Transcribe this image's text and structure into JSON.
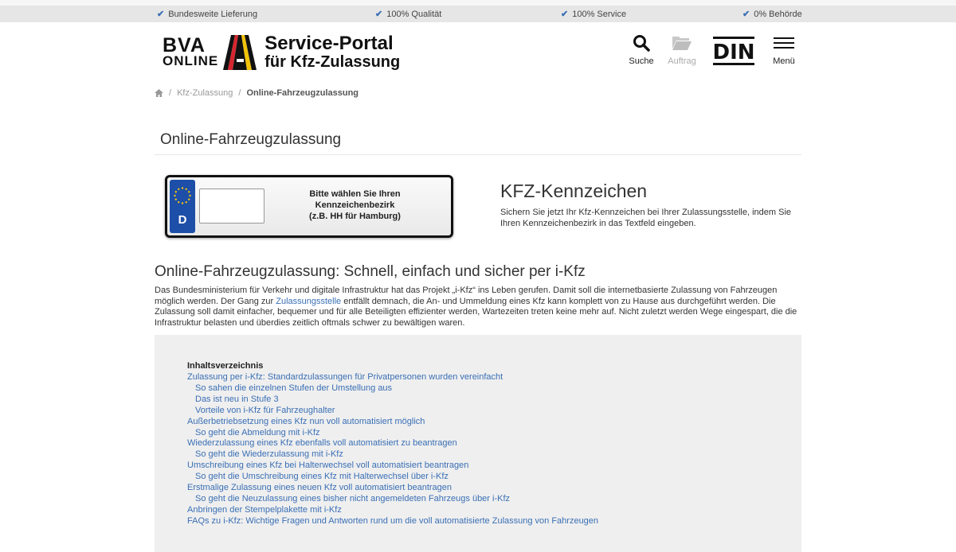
{
  "topbar": {
    "usps": [
      "Bundesweite Lieferung",
      "100% Qualität",
      "100% Service",
      "0% Behörde"
    ]
  },
  "header": {
    "logo_bva": "BVA",
    "logo_online": "ONLINE",
    "logo_portal_line1": "Service-Portal",
    "logo_portal_line2": "für Kfz-Zulassung",
    "search_label": "Suche",
    "order_label": "Auftrag",
    "din_label": "DIN",
    "menu_label": "Menü"
  },
  "breadcrumb": {
    "separator": "/",
    "item1": "Kfz-Zulassung",
    "current": "Online-Fahrzeugzulassung"
  },
  "page_title": "Online-Fahrzeugzulassung",
  "plate": {
    "country": "D",
    "input_value": "",
    "hint_line1": "Bitte wählen Sie Ihren Kennzeichenbezirk",
    "hint_line2": "(z.B. HH für Hamburg)"
  },
  "kfz": {
    "title": "KFZ-Kennzeichen",
    "text": "Sichern Sie jetzt Ihr Kfz-Kennzeichen bei Ihrer Zulassungsstelle, indem Sie Ihren Kennzeichenbezirk in das Textfeld eingeben."
  },
  "main": {
    "heading": "Online-Fahrzeugzulassung: Schnell, einfach und sicher per i-Kfz",
    "intro_part1": "Das Bundesministerium für Verkehr und digitale Infrastruktur hat das Projekt „i-Kfz“ ins Leben gerufen. Damit soll die internetbasierte Zulassung von Fahrzeugen möglich werden. Der Gang zur ",
    "intro_link": "Zulassungsstelle",
    "intro_part2": " entfällt demnach, die An- und Ummeldung eines Kfz kann komplett von zu Hause aus durchgeführt werden. Die Zulassung soll damit einfacher, bequemer und für alle Beteiligten effizienter werden, Wartezeiten treten keine mehr auf. Nicht zuletzt werden Wege eingespart, die die Infrastruktur belasten und überdies zeitlich oftmals schwer zu bewältigen waren."
  },
  "toc": {
    "title": "Inhaltsverzeichnis",
    "items": [
      {
        "label": "Zulassung per i-Kfz: Standardzulassungen für Privatpersonen wurden vereinfacht",
        "sub": false
      },
      {
        "label": "So sahen die einzelnen Stufen der Umstellung aus",
        "sub": true
      },
      {
        "label": "Das ist neu in Stufe 3",
        "sub": true
      },
      {
        "label": "Vorteile von i-Kfz für Fahrzeughalter",
        "sub": true
      },
      {
        "label": "Außerbetriebsetzung eines Kfz nun voll automatisiert möglich",
        "sub": false
      },
      {
        "label": "So geht die Abmeldung mit i-Kfz",
        "sub": true
      },
      {
        "label": "Wiederzulassung eines Kfz ebenfalls voll automatisiert zu beantragen",
        "sub": false
      },
      {
        "label": "So geht die Wiederzulassung mit i-Kfz",
        "sub": true
      },
      {
        "label": "Umschreibung eines Kfz bei Halterwechsel voll automatisiert beantragen",
        "sub": false
      },
      {
        "label": "So geht die Umschreibung eines Kfz mit Halterwechsel über i-Kfz",
        "sub": true
      },
      {
        "label": "Erstmalige Zulassung eines neuen Kfz voll automatisiert beantragen",
        "sub": false
      },
      {
        "label": "So geht die Neuzulassung eines bisher nicht angemeldeten Fahrzeugs über i-Kfz",
        "sub": true
      },
      {
        "label": "Anbringen der Stempelplakette mit i-Kfz",
        "sub": false
      },
      {
        "label": "FAQs zu i-Kfz: Wichtige Fragen und Antworten rund um die voll automatisierte Zulassung von Fahrzeugen",
        "sub": false
      }
    ]
  },
  "icons": {
    "check": "check-icon",
    "search": "search-icon",
    "order": "folder-icon",
    "menu": "hamburger-menu-icon",
    "home": "home-icon"
  },
  "colors": {
    "link": "#3a6fb5",
    "plate_blue": "#1d4fa8",
    "topbar_bg": "#e6e6e6",
    "toc_bg": "#efefef"
  }
}
